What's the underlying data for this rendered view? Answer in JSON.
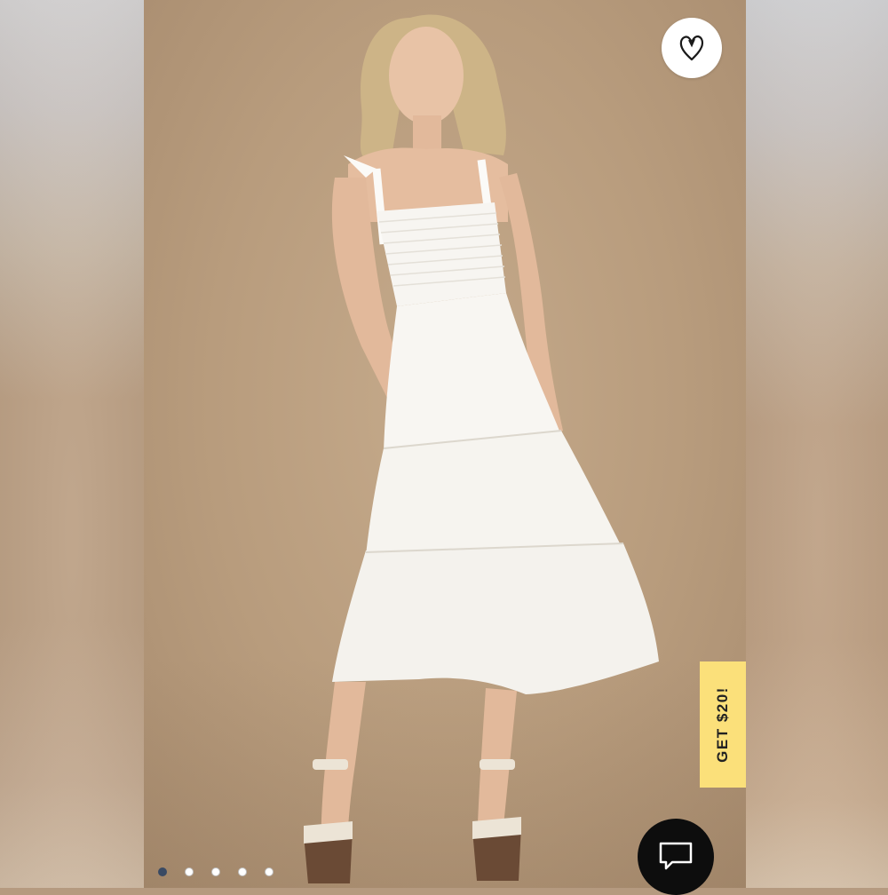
{
  "gallery": {
    "image_alt": "",
    "slide_count": 5,
    "active_slide": 1
  },
  "wishlist": {
    "icon": "heart-icon"
  },
  "promo": {
    "label": "GET $20!",
    "color": "#fbe07a"
  },
  "chat": {
    "icon": "chat-bubble-icon"
  },
  "colors": {
    "backdrop": "#b89c7d",
    "dress": "#f7f5f1",
    "active_dot": "#3a4a63"
  }
}
